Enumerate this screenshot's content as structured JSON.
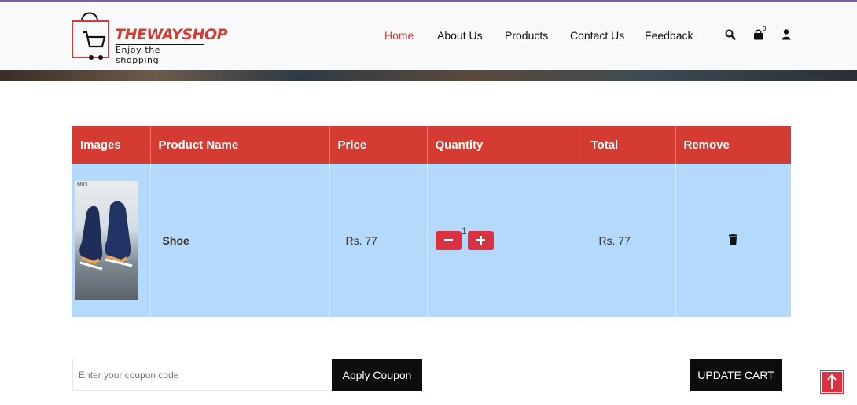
{
  "brand": {
    "name": "THEWAYSHOP",
    "tagline": "Enjoy the shopping",
    "accent": "#d33b33"
  },
  "nav": {
    "items": [
      {
        "label": "Home",
        "active": true
      },
      {
        "label": "About Us",
        "active": false
      },
      {
        "label": "Products",
        "active": false
      },
      {
        "label": "Contact Us",
        "active": false
      },
      {
        "label": "Feedback",
        "active": false
      }
    ],
    "icons": [
      "search-icon",
      "shopping-bag-icon",
      "user-icon"
    ],
    "cart_count": "3"
  },
  "cart": {
    "headers": [
      "Images",
      "Product Name",
      "Price",
      "Quantity",
      "Total",
      "Remove"
    ],
    "rows": [
      {
        "image_text": "MIO",
        "name": "Shoe",
        "price": "Rs. 77",
        "quantity": "1",
        "total": "Rs. 77"
      }
    ],
    "header_color": "#d33b33",
    "row_color": "#b5d9fb"
  },
  "coupon": {
    "placeholder": "Enter your coupon code",
    "apply_label": "Apply Coupon"
  },
  "update_label": "UPDATE CART"
}
